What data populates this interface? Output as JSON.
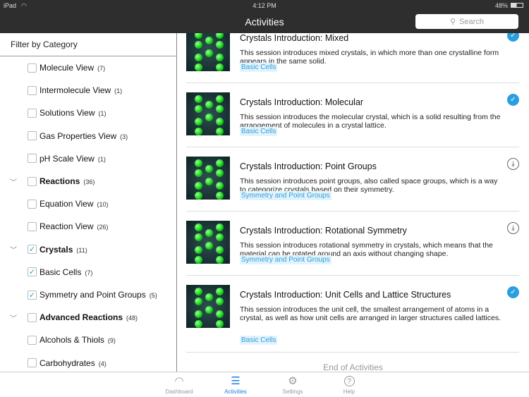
{
  "status_bar": {
    "device": "iPad",
    "time": "4:12 PM",
    "battery": "48%"
  },
  "nav": {
    "title": "Activities",
    "search_placeholder": "Search"
  },
  "sidebar": {
    "header": "Filter by Category",
    "items": [
      {
        "label": "Molecule View",
        "count": "(7)",
        "level": 1,
        "checked": false
      },
      {
        "label": "Intermolecule View",
        "count": "(1)",
        "level": 1,
        "checked": false
      },
      {
        "label": "Solutions View",
        "count": "(1)",
        "level": 1,
        "checked": false
      },
      {
        "label": "Gas Properties View",
        "count": "(3)",
        "level": 1,
        "checked": false
      },
      {
        "label": "pH Scale View",
        "count": "(1)",
        "level": 1,
        "checked": false
      },
      {
        "label": "Reactions",
        "count": "(36)",
        "level": 0,
        "checked": false,
        "expanded": true
      },
      {
        "label": "Equation View",
        "count": "(10)",
        "level": 1,
        "checked": false
      },
      {
        "label": "Reaction View",
        "count": "(26)",
        "level": 1,
        "checked": false
      },
      {
        "label": "Crystals",
        "count": "(11)",
        "level": 0,
        "checked": true,
        "expanded": true
      },
      {
        "label": "Basic Cells",
        "count": "(7)",
        "level": 1,
        "checked": true
      },
      {
        "label": "Symmetry and Point Groups",
        "count": "(5)",
        "level": 1,
        "checked": true
      },
      {
        "label": "Advanced Reactions",
        "count": "(48)",
        "level": 0,
        "checked": false,
        "expanded": true
      },
      {
        "label": "Alcohols & Thiols",
        "count": "(9)",
        "level": 1,
        "checked": false
      },
      {
        "label": "Carbohydrates",
        "count": "(4)",
        "level": 1,
        "checked": false
      }
    ]
  },
  "activities": [
    {
      "title": "Crystals Introduction: Mixed",
      "description": "This session introduces mixed crystals, in which more than one crystalline form appears in the same solid.",
      "tag": "Basic Cells",
      "status": "completed"
    },
    {
      "title": "Crystals Introduction: Molecular",
      "description": "This session introduces the molecular crystal, which is a solid resulting from the arrangement of molecules in a crystal lattice.",
      "tag": "Basic Cells",
      "status": "completed"
    },
    {
      "title": "Crystals Introduction: Point Groups",
      "description": "This session introduces point groups, also called space groups, which is a way to categorize crystals based on their symmetry.",
      "tag": "Symmetry and Point Groups",
      "status": "download"
    },
    {
      "title": "Crystals Introduction: Rotational Symmetry",
      "description": "This session introduces rotational symmetry in crystals, which means that the material can be rotated around an axis without changing shape.",
      "tag": "Symmetry and Point Groups",
      "status": "download"
    },
    {
      "title": "Crystals Introduction: Unit Cells and Lattice Structures",
      "description": "This session introduces  the unit cell, the smallest arrangement  of atoms in a crystal, as well as how unit cells are arranged in larger structures called lattices.",
      "tag": "Basic Cells",
      "status": "completed"
    }
  ],
  "end_text": "End of Activities",
  "tabs": [
    {
      "label": "Dashboard",
      "icon": "gauge-icon",
      "active": false
    },
    {
      "label": "Activities",
      "icon": "list-icon",
      "active": true
    },
    {
      "label": "Settings",
      "icon": "gear-icon",
      "active": false
    },
    {
      "label": "Help",
      "icon": "help-icon",
      "active": false
    }
  ],
  "colors": {
    "accent": "#2a9fe0",
    "tab_active": "#1e7de0",
    "bar": "#2e2e2e"
  }
}
